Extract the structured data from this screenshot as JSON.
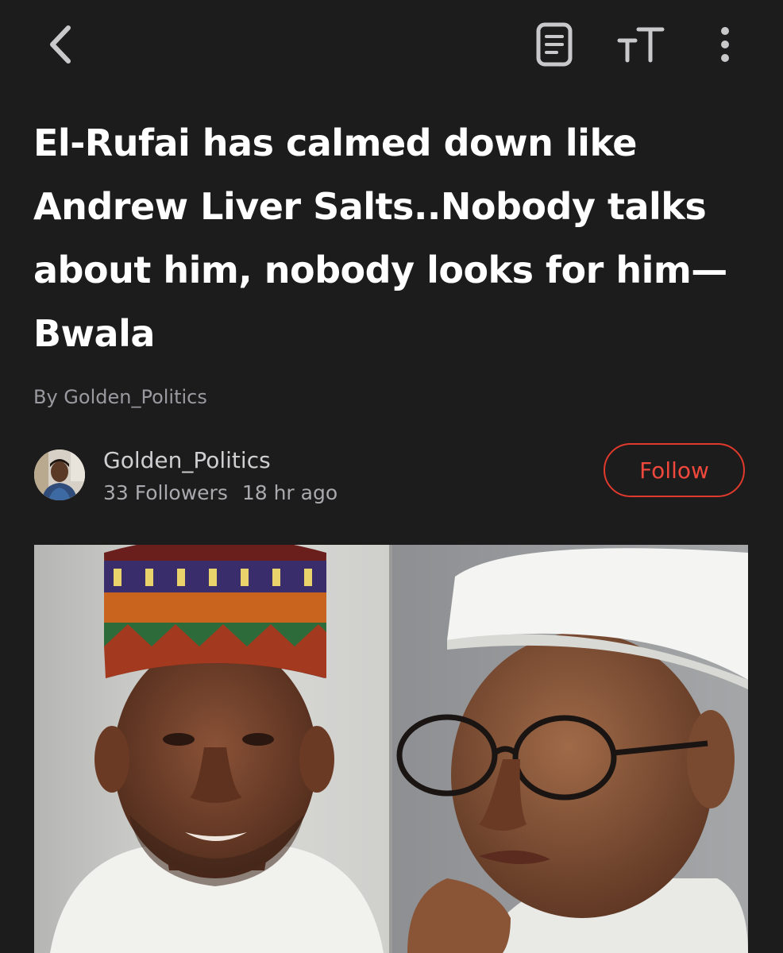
{
  "topbar": {
    "back_icon": "chevron-left-icon",
    "reader_icon": "document-icon",
    "text_size_icon": "text-size-icon",
    "more_icon": "more-vertical-icon"
  },
  "article": {
    "headline": "El-Rufai has calmed down like Andrew Liver Salts..Nobody talks about him, nobody looks for him—Bwala",
    "byline": "By Golden_Politics"
  },
  "author": {
    "name": "Golden_Politics",
    "followers": "33 Followers",
    "time_ago": "18 hr ago",
    "follow_label": "Follow"
  },
  "colors": {
    "background": "#1c1c1c",
    "accent": "#e0392d",
    "text_primary": "#ffffff",
    "text_secondary": "#9a9aa0"
  }
}
